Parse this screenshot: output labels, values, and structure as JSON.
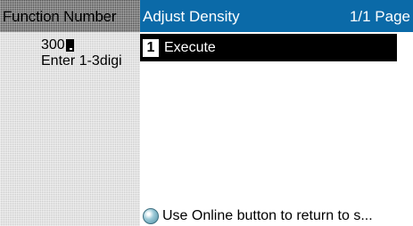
{
  "left": {
    "title": "Function Number",
    "input_value": "300",
    "hint": "Enter 1-3digi"
  },
  "right": {
    "title": "Adjust Density",
    "page_indicator": "1/1 Page",
    "menu": [
      {
        "number": "1",
        "label": "Execute"
      }
    ],
    "footer": "Use Online button to return to s..."
  },
  "colors": {
    "header_blue": "#0b6aa8",
    "selection_black": "#000000",
    "panel_gray": "#c8c8c8"
  },
  "icons": {
    "cursor": "input-cursor-icon",
    "online": "online-button-icon"
  }
}
